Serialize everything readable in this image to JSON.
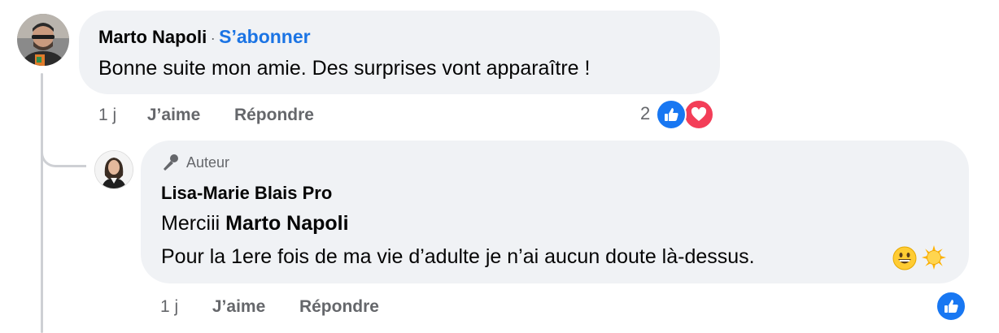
{
  "thread": {
    "comment": {
      "author": "Marto Napoli",
      "separator": "·",
      "follow_label": "S’abonner",
      "text": "Bonne suite mon amie. Des surprises vont apparaître !",
      "time": "1 j",
      "like_label": "J’aime",
      "reply_label": "Répondre",
      "reaction_count": "2",
      "reactions": [
        "like",
        "love"
      ]
    },
    "reply": {
      "badge_label": "Auteur",
      "author": "Lisa-Marie Blais Pro",
      "line1_prefix": "Merciii",
      "line1_mention": "Marto Napoli",
      "line2": "Pour la 1ere fois de ma vie d’adulte je n’ai aucun doute là-dessus.",
      "emojis": [
        "grinning-face",
        "sun"
      ],
      "time": "1 j",
      "like_label": "J’aime",
      "reply_label": "Répondre",
      "reactions": [
        "like"
      ]
    }
  },
  "colors": {
    "link_blue": "#1b74e4",
    "like_blue": "#1877f2",
    "love_red": "#f33e58",
    "bubble_bg": "#f0f2f5",
    "meta_gray": "#65676b"
  }
}
